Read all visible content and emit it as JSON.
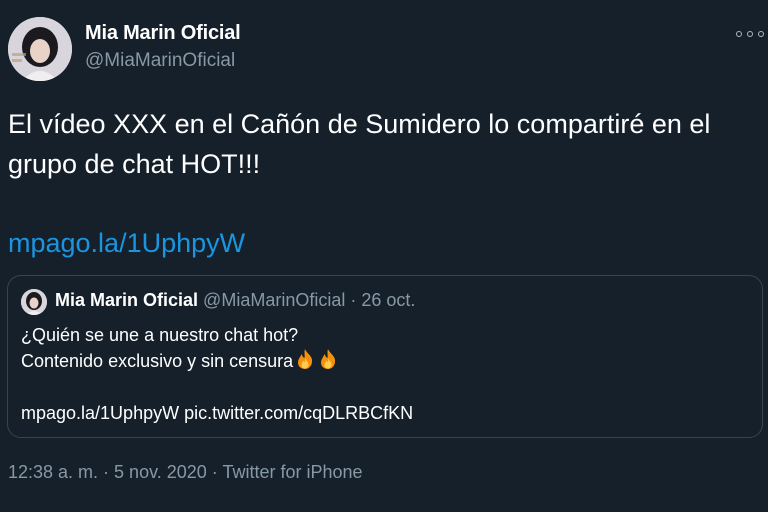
{
  "author": {
    "name": "Mia Marin Oficial",
    "handle": "@MiaMarinOficial"
  },
  "tweet": {
    "text": "El vídeo XXX en el Cañón de Sumidero lo compartiré en el grupo de chat HOT!!!",
    "link": "mpago.la/1UphpyW"
  },
  "quoted_tweet": {
    "name": "Mia Marin Oficial",
    "meta": " @MiaMarinOficial · 26 oct.",
    "line1": "¿Quién se une a nuestro chat hot?",
    "line2": "Contenido exclusivo y sin censura",
    "line4": "mpago.la/1UphpyW pic.twitter.com/cqDLRBCfKN"
  },
  "footer": {
    "timestamp": "12:38 a. m. · 5 nov. 2020 · Twitter for iPhone"
  },
  "icons": [
    "avatar",
    "more-icon",
    "fire-emoji"
  ],
  "colors": {
    "background": "#15202b",
    "link": "#1b95e0",
    "secondary_text": "#8899a6",
    "border": "#38444d"
  }
}
